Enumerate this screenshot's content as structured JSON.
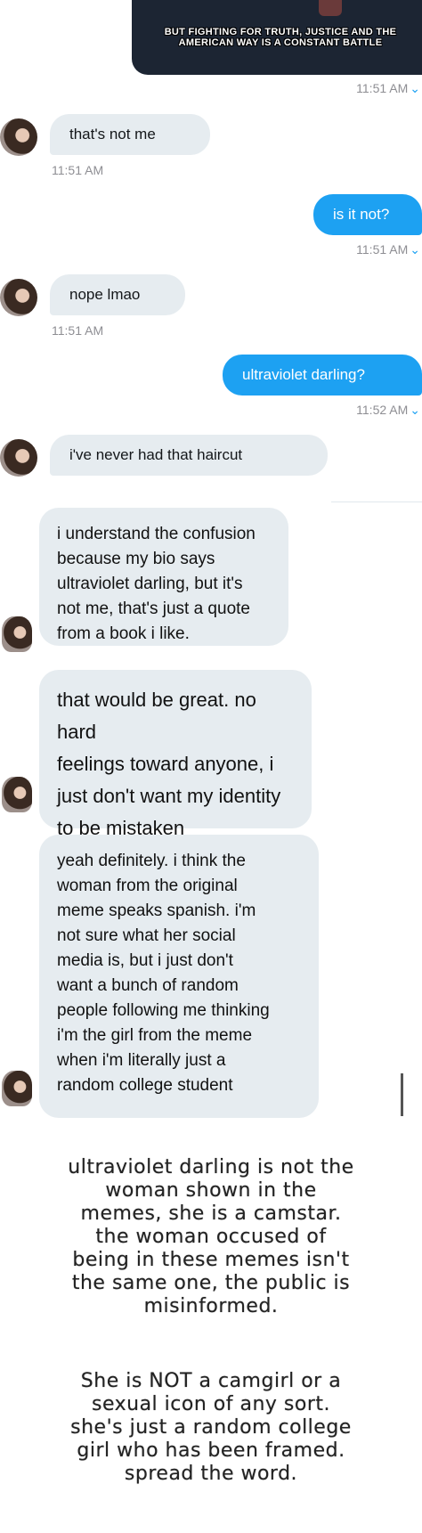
{
  "image_message": {
    "caption": "BUT FIGHTING FOR TRUTH, JUSTICE AND THE AMERICAN WAY IS A CONSTANT BATTLE"
  },
  "messages": [
    {
      "dir": "out-time",
      "time": "11:51 AM"
    },
    {
      "dir": "in",
      "text": "that's not me",
      "time": "11:51 AM"
    },
    {
      "dir": "out",
      "text": "is it not?",
      "time": "11:51 AM"
    },
    {
      "dir": "in",
      "text": "nope lmao",
      "time": "11:51 AM"
    },
    {
      "dir": "out",
      "text": "ultraviolet darling?",
      "time": "11:52 AM"
    },
    {
      "dir": "in",
      "text": "i've never had that haircut"
    }
  ],
  "screenshot_messages": [
    "i understand the confusion\nbecause my bio says\nultraviolet darling, but it's\nnot me, that's just a quote\nfrom a book i like.",
    "that would be great. no hard\nfeelings toward anyone, i\njust don't want my identity\nto be mistaken",
    "yeah definitely. i think the\nwoman from the original\nmeme speaks spanish. i'm\nnot sure what her social\nmedia is, but i just don't\nwant a bunch of random\npeople following me thinking\ni'm the girl from the meme\nwhen i'm literally just a\nrandom college student"
  ],
  "notice": {
    "paragraph1": "ultraviolet darling is not the\nwoman shown in the\nmemes, she is a camstar.\nthe woman occused of\nbeing in these memes isn't\nthe same one, the public is\nmisinformed.",
    "paragraph2": "She is NOT a camgirl or a\nsexual icon of any sort.\nshe's just a random college\ngirl who has been framed.\nspread the word."
  },
  "icons": [
    "avatar",
    "read-check-icon"
  ],
  "colors": {
    "outgoing": "#1da1f2",
    "incoming": "#e6ecf0",
    "timestamp": "#8e8e93"
  }
}
